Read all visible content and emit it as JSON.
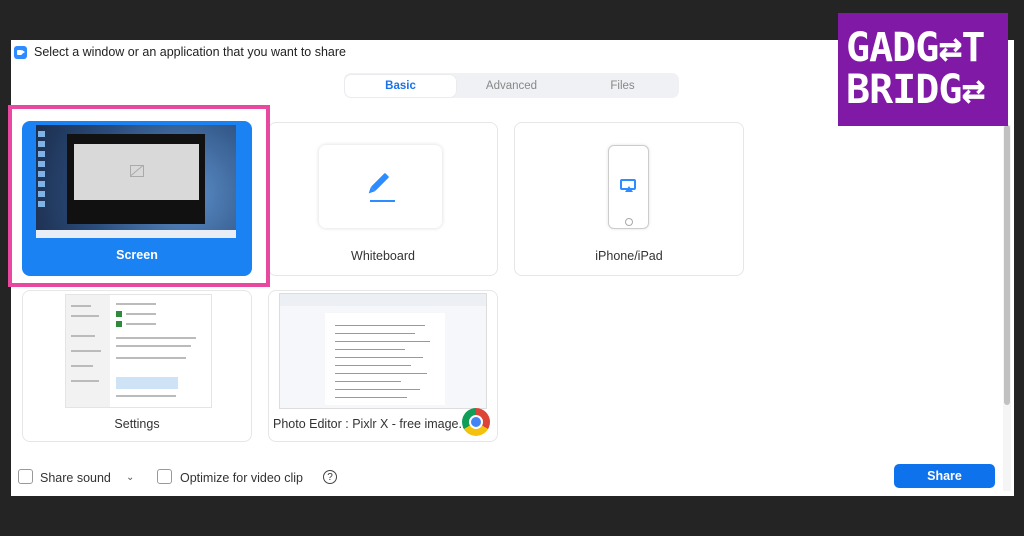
{
  "dialog": {
    "title": "Select a window or an application that you want to share"
  },
  "tabs": [
    {
      "label": "Basic",
      "active": true
    },
    {
      "label": "Advanced",
      "active": false
    },
    {
      "label": "Files",
      "active": false
    }
  ],
  "share_options": [
    {
      "label": "Screen",
      "selected": true
    },
    {
      "label": "Whiteboard",
      "selected": false
    },
    {
      "label": "iPhone/iPad",
      "selected": false
    },
    {
      "label": "Settings",
      "selected": false
    },
    {
      "label": "Photo Editor : Pixlr X - free image...",
      "selected": false
    }
  ],
  "bottom_bar": {
    "share_sound_label": "Share sound",
    "share_sound_checked": false,
    "optimize_label": "Optimize for video clip",
    "optimize_checked": false,
    "help_glyph": "?",
    "share_button_label": "Share"
  },
  "watermark": {
    "text": "GADGET BRIDGE",
    "color": "#8019a5"
  },
  "colors": {
    "accent": "#0e72ed",
    "selection_highlight": "#e8489f"
  },
  "icons": [
    "zoom-logo-icon",
    "pencil-icon",
    "airplay-icon",
    "chrome-icon",
    "chevron-down-icon",
    "help-icon",
    "camera-off-icon"
  ]
}
